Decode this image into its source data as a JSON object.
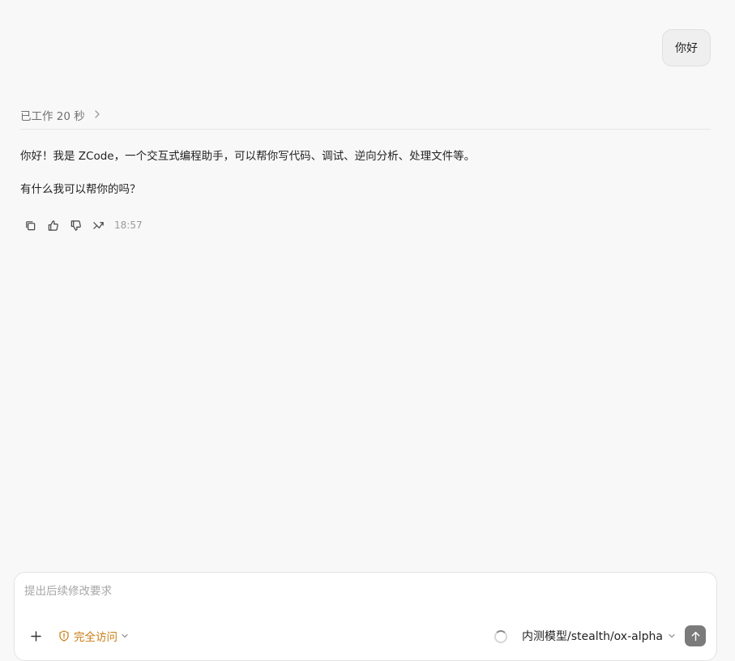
{
  "conversation": {
    "user_message": "你好",
    "worked_status": "已工作 20 秒",
    "reply_paragraphs": [
      "你好！我是 ZCode，一个交互式编程助手，可以帮你写代码、调试、逆向分析、处理文件等。",
      "有什么我可以帮你的吗？"
    ],
    "timestamp": "18:57",
    "action_icons": [
      "copy-icon",
      "thumbs-up-icon",
      "thumbs-down-icon",
      "branch-icon"
    ]
  },
  "composer": {
    "placeholder": "提出后续修改要求",
    "access_mode": "完全访问",
    "model": "内测模型/stealth/ox-alpha"
  },
  "colors": {
    "background": "#f8f8f8",
    "access_accent": "#c97c10",
    "send_button": "#7b7b7b"
  }
}
